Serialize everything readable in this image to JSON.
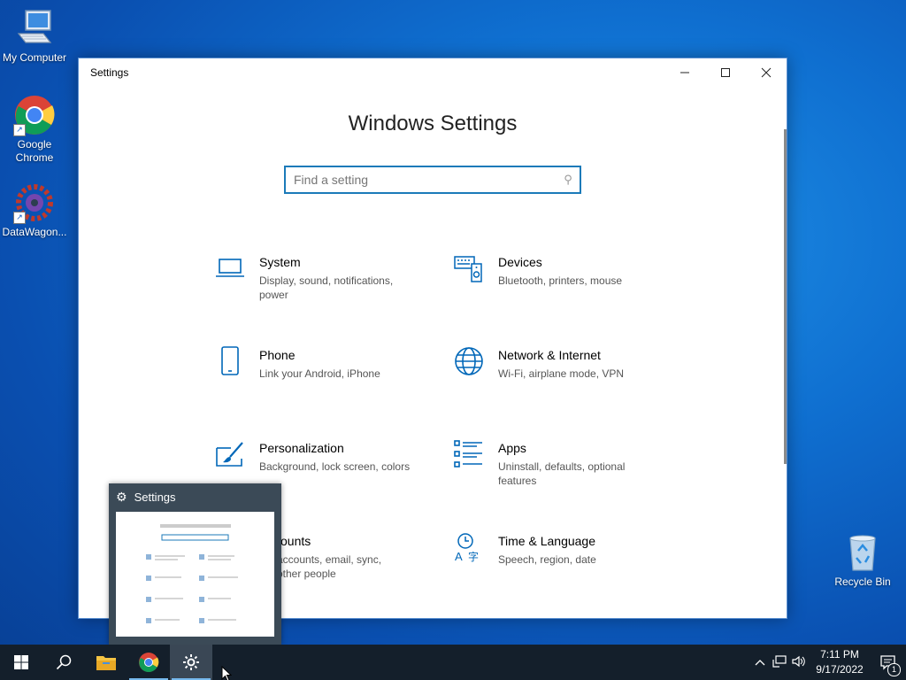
{
  "desktop": {
    "icons": [
      {
        "label": "My Computer"
      },
      {
        "label": "Google Chrome"
      },
      {
        "label": "DataWagon..."
      },
      {
        "label": "Recycle Bin"
      }
    ]
  },
  "window": {
    "title": "Settings",
    "heading": "Windows Settings",
    "search_placeholder": "Find a setting",
    "tiles": [
      {
        "name": "System",
        "desc": "Display, sound, notifications, power",
        "icon": "laptop-icon"
      },
      {
        "name": "Devices",
        "desc": "Bluetooth, printers, mouse",
        "icon": "keyboard-speaker-icon"
      },
      {
        "name": "Phone",
        "desc": "Link your Android, iPhone",
        "icon": "phone-icon"
      },
      {
        "name": "Network & Internet",
        "desc": "Wi-Fi, airplane mode, VPN",
        "icon": "globe-icon"
      },
      {
        "name": "Personalization",
        "desc": "Background, lock screen, colors",
        "icon": "paintbrush-icon"
      },
      {
        "name": "Apps",
        "desc": "Uninstall, defaults, optional features",
        "icon": "apps-list-icon"
      },
      {
        "name": "ounts",
        "desc": "accounts, email, sync, other people",
        "icon": "person-icon"
      },
      {
        "name": "Time & Language",
        "desc": "Speech, region, date",
        "icon": "time-language-icon"
      }
    ]
  },
  "thumbnail": {
    "title": "Settings"
  },
  "taskbar": {
    "time": "7:11 PM",
    "date": "9/17/2022",
    "notification_count": "1"
  },
  "colors": {
    "accent": "#0067b8",
    "taskbar": "#141f2b"
  }
}
